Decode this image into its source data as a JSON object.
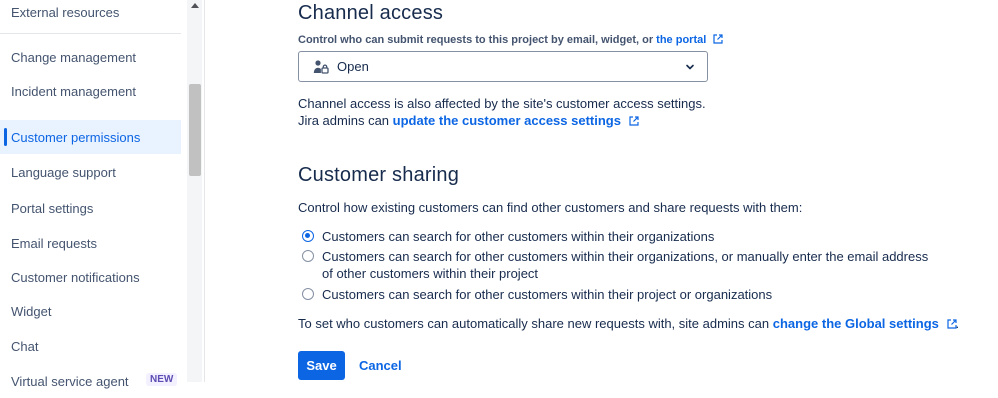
{
  "sidebar": {
    "items": [
      {
        "label": "External resources"
      },
      {
        "label": "Change management"
      },
      {
        "label": "Incident management"
      },
      {
        "label": "Customer permissions",
        "active": true
      },
      {
        "label": "Language support"
      },
      {
        "label": "Portal settings"
      },
      {
        "label": "Email requests"
      },
      {
        "label": "Customer notifications"
      },
      {
        "label": "Widget"
      },
      {
        "label": "Chat"
      },
      {
        "label": "Virtual service agent",
        "badge": "NEW"
      }
    ]
  },
  "channel_access": {
    "title": "Channel access",
    "control_label": "Control who can submit requests to this project by email, widget, or",
    "portal_link": "the portal",
    "select_value": "Open",
    "note_line1": "Channel access is also affected by the site's customer access settings.",
    "note_line2_prefix": "Jira admins can",
    "note_link": "update the customer access settings"
  },
  "customer_sharing": {
    "title": "Customer sharing",
    "description": "Control how existing customers can find other customers and share requests with them:",
    "options": [
      {
        "label": "Customers can search for other customers within their organizations",
        "checked": true
      },
      {
        "label": "Customers can search for other customers within their organizations, or manually enter the email address of other customers within their project",
        "checked": false
      },
      {
        "label": "Customers can search for other customers within their project or organizations",
        "checked": false
      }
    ],
    "global_prefix": "To set who customers can automatically share new requests with, site admins can",
    "global_link": "change the Global settings",
    "global_suffix": "."
  },
  "actions": {
    "save": "Save",
    "cancel": "Cancel"
  },
  "colors": {
    "accent": "#0c66e4",
    "active_bg": "#e9f2ff",
    "text": "#172b4d"
  }
}
